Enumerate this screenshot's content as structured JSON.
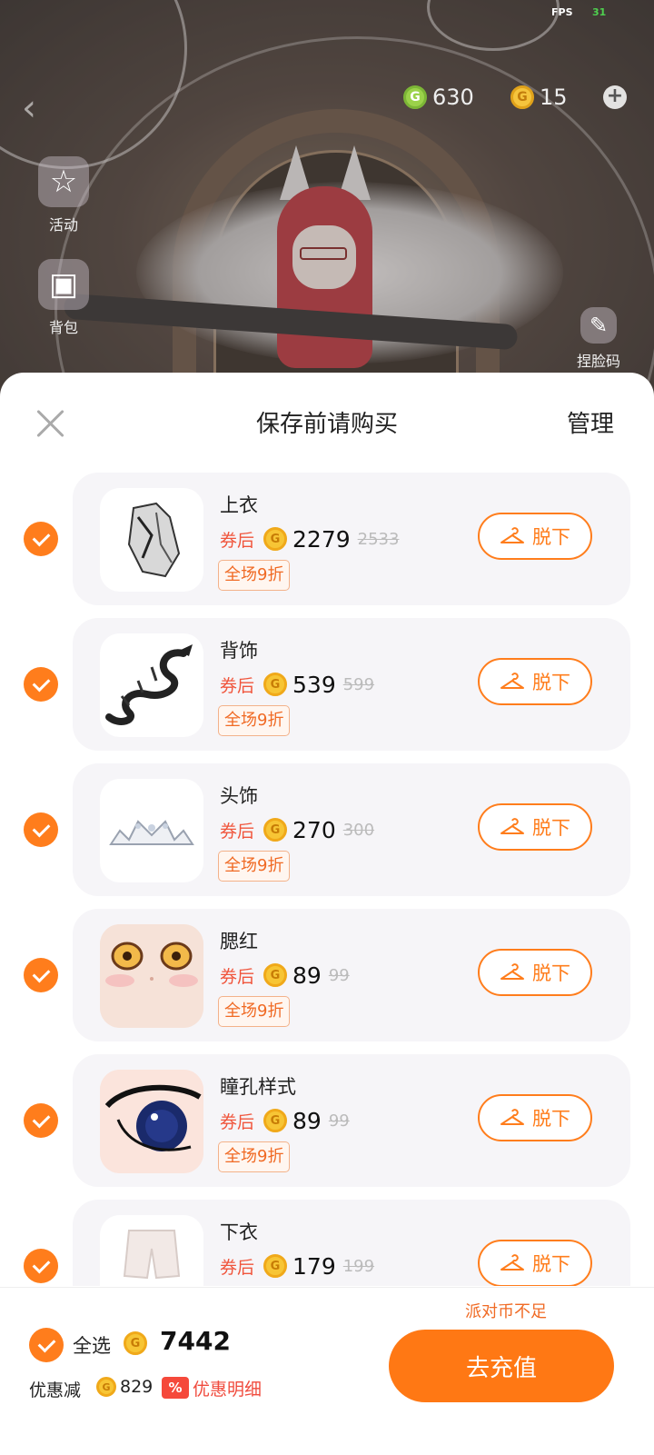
{
  "status": {
    "fps_label": "FPS",
    "fps_value": "31"
  },
  "hud": {
    "currency_green": {
      "icon": "green-coin-icon",
      "value": "630"
    },
    "currency_gold": {
      "icon": "gold-coin-icon",
      "value": "15"
    },
    "side_left_1": {
      "label": "活动",
      "icon": "star-event-icon"
    },
    "side_left_2": {
      "label": "背包",
      "icon": "gift-box-icon"
    },
    "side_right": {
      "label": "捏脸码",
      "icon": "edit-icon"
    }
  },
  "sheet": {
    "title": "保存前请购买",
    "manage_label": "管理"
  },
  "coin_glyph": "G",
  "coupon_label": "券后",
  "remove_label": "脱下",
  "items": [
    {
      "name": "上衣",
      "price": "2279",
      "original": "2533",
      "tag": "全场9折",
      "checked": true
    },
    {
      "name": "背饰",
      "price": "539",
      "original": "599",
      "tag": "全场9折",
      "checked": true
    },
    {
      "name": "头饰",
      "price": "270",
      "original": "300",
      "tag": "全场9折",
      "checked": true
    },
    {
      "name": "腮红",
      "price": "89",
      "original": "99",
      "tag": "全场9折",
      "checked": true
    },
    {
      "name": "瞳孔样式",
      "price": "89",
      "original": "99",
      "tag": "全场9折",
      "checked": true
    },
    {
      "name": "下衣",
      "price": "179",
      "original": "199",
      "tag": "",
      "checked": true
    }
  ],
  "footer": {
    "insufficient_label": "派对币不足",
    "select_all_label": "全选",
    "total": "7442",
    "discount_label": "优惠减",
    "discount_amount": "829",
    "pct_glyph": "%",
    "detail_label": "优惠明细",
    "recharge_label": "去充值"
  },
  "colors": {
    "accent": "#ff7d1c",
    "coupon_red": "#f0553c",
    "coin_gold": "#f7c535"
  }
}
